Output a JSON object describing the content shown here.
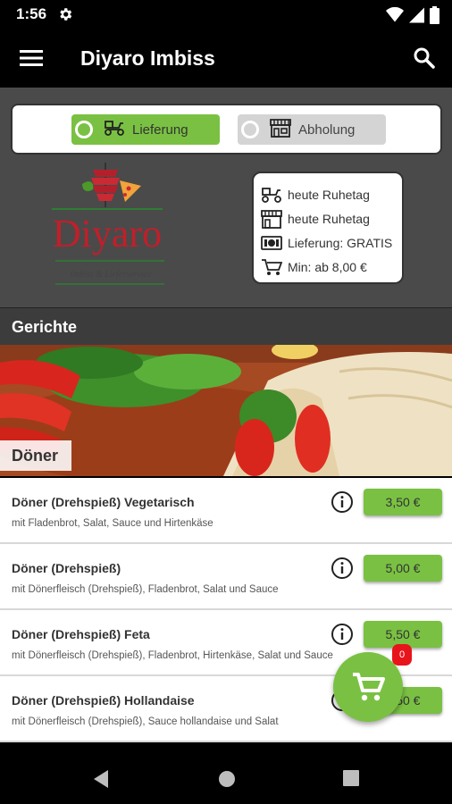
{
  "status_bar": {
    "time": "1:56"
  },
  "app_bar": {
    "title": "Diyaro Imbiss"
  },
  "mode_toggle": {
    "delivery_label": "Lieferung",
    "pickup_label": "Abholung",
    "selected": "delivery"
  },
  "logo": {
    "name": "Diyaro",
    "tagline": "Imbiss & Lieferservice"
  },
  "info_card": {
    "delivery_hours": "heute Ruhetag",
    "pickup_hours": "heute Ruhetag",
    "delivery_fee": "Lieferung: GRATIS",
    "minimum_order": "Min: ab 8,00 €"
  },
  "section": {
    "title": "Gerichte"
  },
  "category": {
    "name": "Döner"
  },
  "items": [
    {
      "name": "Döner (Drehspieß) Vegetarisch",
      "desc": "mit Fladenbrot, Salat, Sauce und Hirtenkäse",
      "price": "3,50 €"
    },
    {
      "name": "Döner (Drehspieß)",
      "desc": "mit Dönerfleisch (Drehspieß), Fladenbrot, Salat und Sauce",
      "price": "5,00 €"
    },
    {
      "name": "Döner (Drehspieß) Feta",
      "desc": "mit Dönerfleisch (Drehspieß), Fladenbrot, Hirtenkäse, Salat und Sauce",
      "price": "5,50 €"
    },
    {
      "name": "Döner (Drehspieß) Hollandaise",
      "desc": "mit Dönerfleisch (Drehspieß), Sauce hollandaise und Salat",
      "price": "5,50 €"
    }
  ],
  "cart": {
    "count": "0"
  },
  "colors": {
    "accent": "#7ac143",
    "badge": "#e8141c",
    "header_bg": "#4a4a4a"
  }
}
